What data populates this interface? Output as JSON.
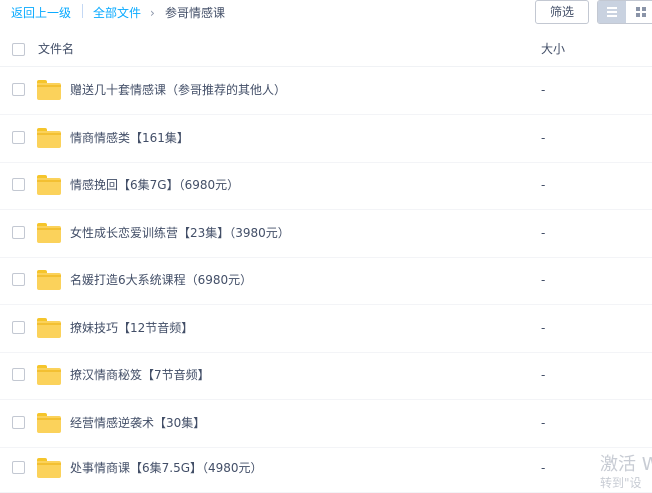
{
  "breadcrumb": {
    "back": "返回上一级",
    "all_files": "全部文件",
    "current": "参哥情感课"
  },
  "toolbar": {
    "filter_label": "筛选",
    "view_mode": "list"
  },
  "table": {
    "col_name": "文件名",
    "col_size": "大小",
    "rows": [
      {
        "name": "赠送几十套情感课（参哥推荐的其他人）",
        "size": "-"
      },
      {
        "name": "情商情感类【161集】",
        "size": "-"
      },
      {
        "name": "情感挽回【6集7G】（6980元）",
        "size": "-"
      },
      {
        "name": "女性成长恋爱训练营【23集】（3980元）",
        "size": "-"
      },
      {
        "name": "名媛打造6大系统课程（6980元）",
        "size": "-"
      },
      {
        "name": "撩妹技巧【12节音频】",
        "size": "-"
      },
      {
        "name": "撩汉情商秘笈【7节音频】",
        "size": "-"
      },
      {
        "name": "经营情感逆袭术【30集】",
        "size": "-"
      },
      {
        "name": "处事情商课【6集7.5G】（4980元）",
        "size": "-"
      }
    ]
  },
  "watermark": {
    "line1": "激活 W",
    "line2": "转到\"设"
  },
  "colors": {
    "link": "#09aaff",
    "text": "#424e67",
    "folder": "#fbd25b"
  }
}
